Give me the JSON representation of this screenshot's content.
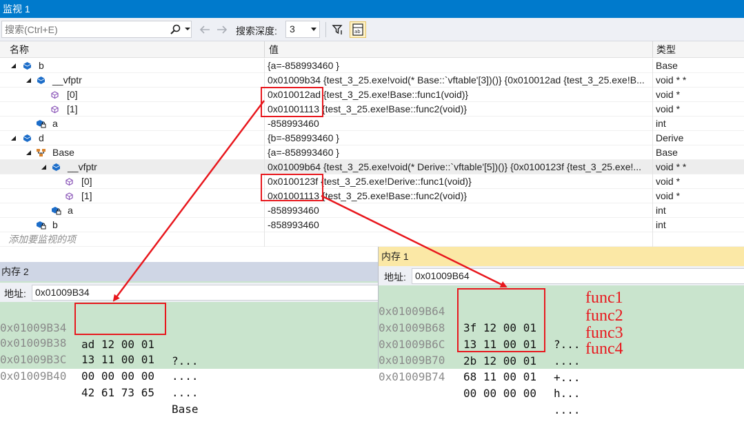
{
  "watch": {
    "title": "监视 1",
    "search_placeholder": "搜索(Ctrl+E)",
    "depth_label": "搜索深度:",
    "depth_value": "3",
    "columns": {
      "name": "名称",
      "value": "值",
      "type": "类型"
    },
    "rows": [
      {
        "name": "b",
        "value": "{a=-858993460 }",
        "type": "Base"
      },
      {
        "name": "__vfptr",
        "value": "0x01009b34 {test_3_25.exe!void(* Base::`vftable'[3])()} {0x010012ad {test_3_25.exe!B...",
        "type": "void * *"
      },
      {
        "name": "[0]",
        "value": "0x010012ad {test_3_25.exe!Base::func1(void)}",
        "type": "void *"
      },
      {
        "name": "[1]",
        "value": "0x01001113 {test_3_25.exe!Base::func2(void)}",
        "type": "void *"
      },
      {
        "name": "a",
        "value": "-858993460",
        "type": "int"
      },
      {
        "name": "d",
        "value": "{b=-858993460 }",
        "type": "Derive"
      },
      {
        "name": "Base",
        "value": "{a=-858993460 }",
        "type": "Base"
      },
      {
        "name": "__vfptr",
        "value": "0x01009b64 {test_3_25.exe!void(* Derive::`vftable'[5])()} {0x0100123f {test_3_25.exe!...",
        "type": "void * *"
      },
      {
        "name": "[0]",
        "value": "0x0100123f {test_3_25.exe!Derive::func1(void)}",
        "type": "void *"
      },
      {
        "name": "[1]",
        "value": "0x01001113 {test_3_25.exe!Base::func2(void)}",
        "type": "void *"
      },
      {
        "name": "a",
        "value": "-858993460",
        "type": "int"
      },
      {
        "name": "b",
        "value": "-858993460",
        "type": "int"
      }
    ],
    "add_watch": "添加要监视的项"
  },
  "memory2": {
    "title": "内存 2",
    "address_label": "地址:",
    "address_value": "0x01009B34",
    "rows": [
      {
        "addr": "0x01009B34",
        "bytes": "ad 12 00 01",
        "ascii": "?..."
      },
      {
        "addr": "0x01009B38",
        "bytes": "13 11 00 01",
        "ascii": "...."
      },
      {
        "addr": "0x01009B3C",
        "bytes": "00 00 00 00",
        "ascii": "...."
      },
      {
        "addr": "0x01009B40",
        "bytes": "42 61 73 65",
        "ascii": "Base"
      }
    ]
  },
  "memory1": {
    "title": "内存 1",
    "address_label": "地址:",
    "address_value": "0x01009B64",
    "rows": [
      {
        "addr": "0x01009B64",
        "bytes": "3f 12 00 01",
        "ascii": "?..."
      },
      {
        "addr": "0x01009B68",
        "bytes": "13 11 00 01",
        "ascii": "...."
      },
      {
        "addr": "0x01009B6C",
        "bytes": "2b 12 00 01",
        "ascii": "+..."
      },
      {
        "addr": "0x01009B70",
        "bytes": "68 11 00 01",
        "ascii": "h..."
      },
      {
        "addr": "0x01009B74",
        "bytes": "00 00 00 00",
        "ascii": "...."
      }
    ]
  },
  "annotations": {
    "labels": [
      "func1",
      "func2",
      "func3",
      "func4"
    ],
    "color": "#e8171d"
  },
  "colors": {
    "title_bar": "#007acc",
    "memory_bg": "#c9e4cd",
    "memory1_title": "#fbe8a6",
    "memory2_title": "#cfd6e5"
  }
}
